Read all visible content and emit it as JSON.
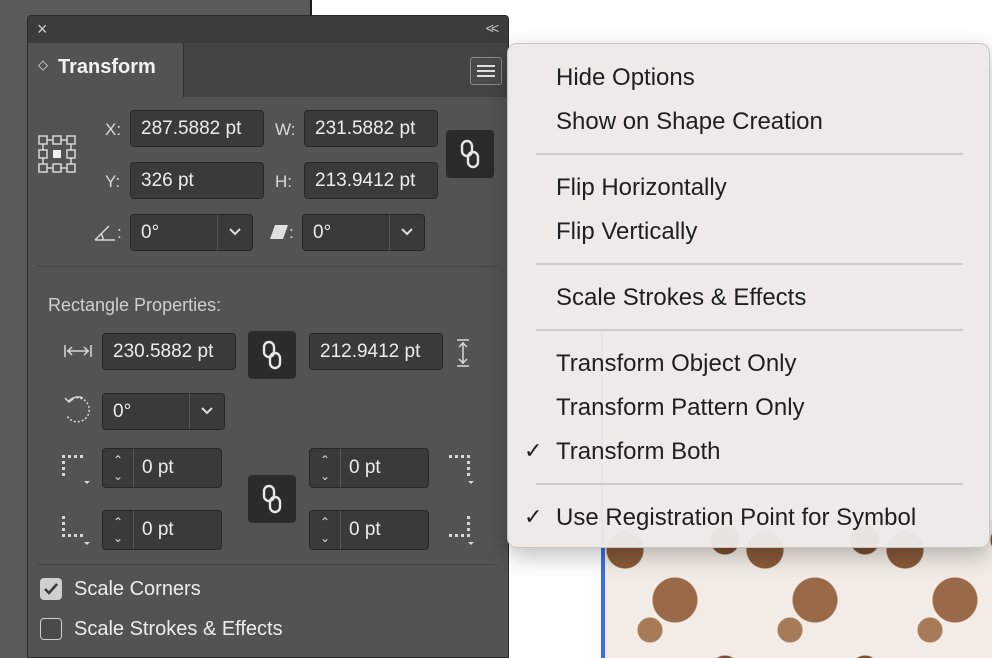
{
  "panel": {
    "close_icon": "×",
    "collapse_icon": "<<",
    "tab_label": "Transform",
    "tab_arrows": "◇",
    "x_label": "X:",
    "x_value": "287.5882 pt",
    "y_label": "Y:",
    "y_value": "326 pt",
    "w_label": "W:",
    "w_value": "231.5882 pt",
    "h_label": "H:",
    "h_value": "213.9412 pt",
    "angle_sep": ":",
    "angle_value": "0°",
    "shear_sep": ":",
    "shear_value": "0°",
    "rect_props_title": "Rectangle Properties:",
    "rect_width": "230.5882 pt",
    "rect_height": "212.9412 pt",
    "rect_rotation": "0°",
    "corner_tl": "0 pt",
    "corner_tr": "0 pt",
    "corner_bl": "0 pt",
    "corner_br": "0 pt",
    "scale_corners_label": "Scale Corners",
    "scale_corners_checked": true,
    "scale_strokes_label": "Scale Strokes & Effects",
    "scale_strokes_checked": false
  },
  "menu": {
    "items": [
      {
        "label": "Hide Options",
        "checked": false
      },
      {
        "label": "Show on Shape Creation",
        "checked": false
      },
      {
        "label": "Flip Horizontally",
        "checked": false
      },
      {
        "label": "Flip Vertically",
        "checked": false
      },
      {
        "label": "Scale Strokes & Effects",
        "checked": false
      },
      {
        "label": "Transform Object Only",
        "checked": false
      },
      {
        "label": "Transform Pattern Only",
        "checked": false
      },
      {
        "label": "Transform Both",
        "checked": true
      },
      {
        "label": "Use Registration Point for Symbol",
        "checked": true
      }
    ],
    "check_glyph": "✓"
  },
  "colors": {
    "panel_bg": "#535353",
    "field_bg": "#3a3a3a",
    "menu_bg": "#ece9e6",
    "selection_blue": "#3b6fe0",
    "checkbox_checked": "#cfcfcf"
  }
}
